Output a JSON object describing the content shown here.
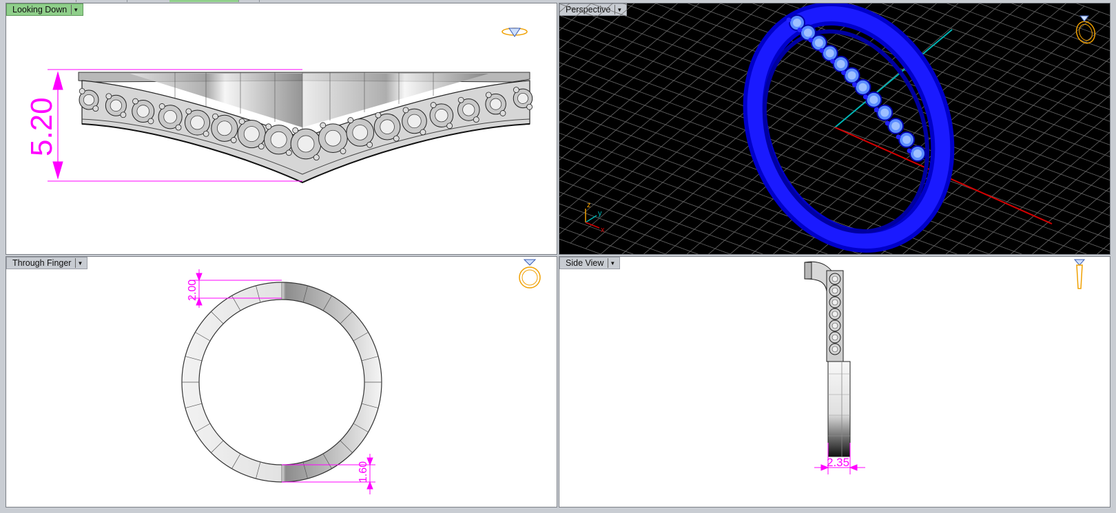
{
  "viewports": {
    "top_left": {
      "label": "Looking Down",
      "active": true,
      "dimension": "5.20"
    },
    "top_right": {
      "label": "Perspective",
      "active": false,
      "axes": {
        "z": "z",
        "y": "y",
        "x": "x"
      }
    },
    "bottom_left": {
      "label": "Through Finger",
      "active": false,
      "dim_top": "2.00",
      "dim_bottom": "1.60"
    },
    "bottom_right": {
      "label": "Side View",
      "active": false,
      "dim_bottom": "2.35"
    }
  },
  "colors": {
    "dimension": "#ff00ff",
    "active_tab": "#8fcf8a",
    "ring_blue": "#0000ff",
    "grid": "#6a6a6a",
    "axis_x": "#d40000",
    "axis_y": "#00b4b4",
    "nav_icon": "#f0a000"
  },
  "icons": {
    "top_left": "gem-top-view-icon",
    "top_right": "ring-perspective-icon",
    "bottom_left": "ring-front-view-icon",
    "bottom_right": "ring-side-view-icon",
    "dropdown": "chevron-down-icon"
  }
}
